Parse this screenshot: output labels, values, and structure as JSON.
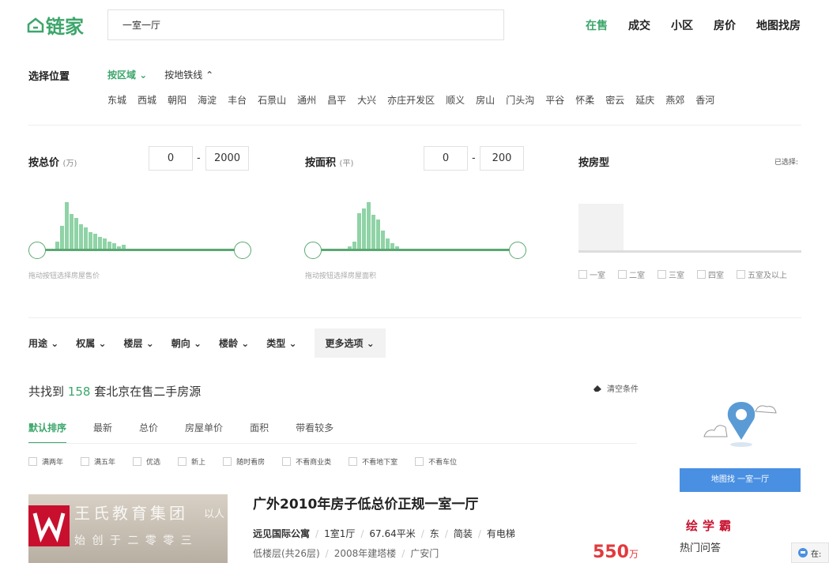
{
  "brand": {
    "logo_text": "链家",
    "accent": "#3ca66b"
  },
  "search": {
    "value": "一室一厅"
  },
  "topnav": [
    "在售",
    "成交",
    "小区",
    "房价",
    "地图找房"
  ],
  "location": {
    "title": "选择位置",
    "tabs": [
      "按区域",
      "按地铁线"
    ],
    "districts": [
      "东城",
      "西城",
      "朝阳",
      "海淀",
      "丰台",
      "石景山",
      "通州",
      "昌平",
      "大兴",
      "亦庄开发区",
      "顺义",
      "房山",
      "门头沟",
      "平谷",
      "怀柔",
      "密云",
      "延庆",
      "燕郊",
      "香河"
    ]
  },
  "price": {
    "title": "按总价",
    "unit": "(万)",
    "min": "0",
    "dash": "-",
    "max": "2000",
    "hint": "拖动按钮选择房屋售价"
  },
  "area": {
    "title": "按面积",
    "unit": "(平)",
    "min": "0",
    "dash": "-",
    "max": "200",
    "hint": "拖动按钮选择房屋面积"
  },
  "rooms": {
    "title": "按房型",
    "selected_label": "已选择:",
    "options": [
      "一室",
      "二室",
      "三室",
      "四室",
      "五室及以上"
    ]
  },
  "filters": [
    "用途",
    "权属",
    "楼层",
    "朝向",
    "楼龄",
    "类型"
  ],
  "more_filters": "更多选项",
  "result": {
    "prefix": "共找到",
    "count": "158",
    "suffix": "套北京在售二手房源",
    "clear": "清空条件"
  },
  "sort": [
    "默认排序",
    "最新",
    "总价",
    "房屋单价",
    "面积",
    "带看较多"
  ],
  "checks": [
    "满两年",
    "满五年",
    "优选",
    "新上",
    "随时看房",
    "不看商业类",
    "不看地下室",
    "不看车位"
  ],
  "listing": {
    "title": "广外2010年房子低总价正规一室一厅",
    "info": [
      "远见国际公寓",
      "1室1厅",
      "67.64平米",
      "东",
      "简装",
      "有电梯"
    ],
    "info2": [
      "低楼层(共26层)",
      "2008年建塔楼",
      "广安门"
    ],
    "price": "550",
    "price_unit": "万",
    "watermark": {
      "line1": "王氏教育集团",
      "line2": "始 创 于 二 零 零 三",
      "extra": "以人"
    }
  },
  "sidebar": {
    "map_button": "地图找 一室一厅",
    "hot": "热门问答",
    "brand_overlay": "绘学霸"
  },
  "chat": {
    "label": "在:"
  }
}
